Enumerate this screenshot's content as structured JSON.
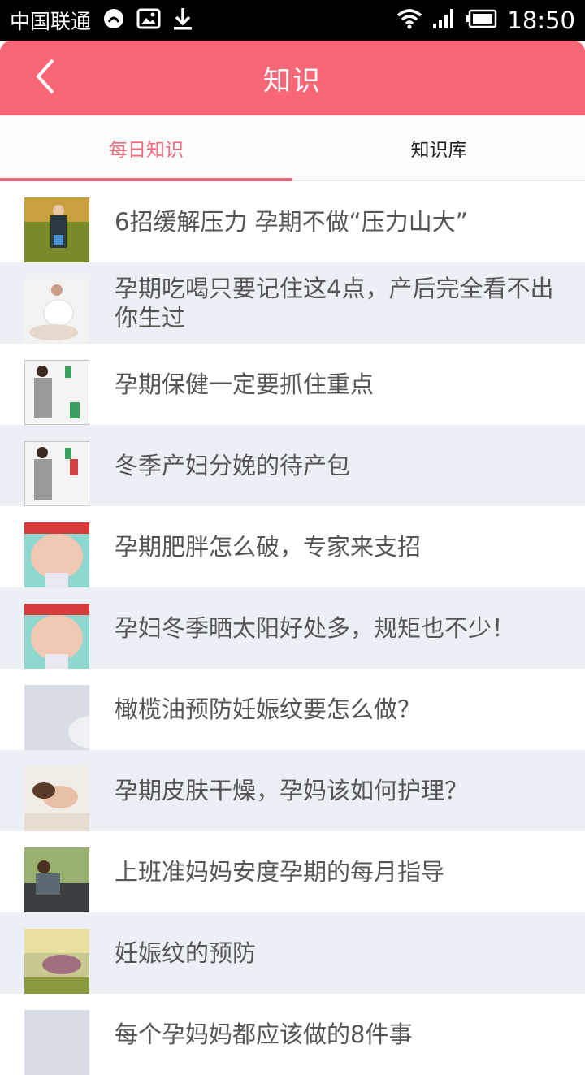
{
  "status_bar": {
    "carrier": "中国联通",
    "time": "18:50"
  },
  "header": {
    "title": "知识"
  },
  "tabs": [
    {
      "label": "每日知识",
      "active": true
    },
    {
      "label": "知识库",
      "active": false
    }
  ],
  "articles": [
    {
      "title": "6招缓解压力 孕期不做“压力山大”"
    },
    {
      "title": "孕期吃喝只要记住这4点，产后完全看不出你生过"
    },
    {
      "title": "孕期保健一定要抓住重点"
    },
    {
      "title": "冬季产妇分娩的待产包"
    },
    {
      "title": "孕期肥胖怎么破，专家来支招"
    },
    {
      "title": "孕妇冬季晒太阳好处多，规矩也不少！"
    },
    {
      "title": "橄榄油预防妊娠纹要怎么做？"
    },
    {
      "title": "孕期皮肤干燥，孕妈该如何护理？"
    },
    {
      "title": "上班准妈妈安度孕期的每月指导"
    },
    {
      "title": "妊娠纹的预防"
    },
    {
      "title": "每个孕妈妈都应该做的8件事"
    }
  ],
  "colors": {
    "accent": "#f96777",
    "tab_active": "#f06a7b",
    "alt_row": "#eceff5"
  }
}
